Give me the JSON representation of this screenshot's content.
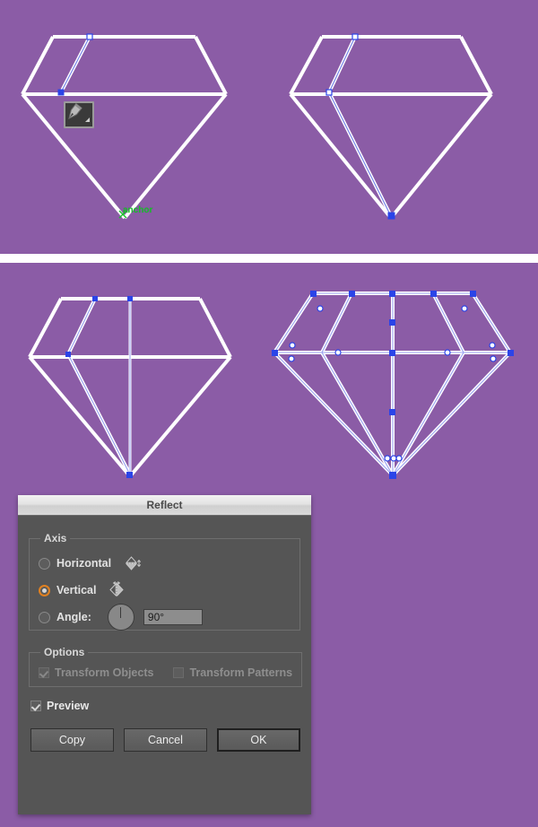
{
  "app": {
    "canvas_background": "#8b5ca6",
    "artwork_stroke": "#ffffff",
    "selection_color": "#2b44e8",
    "smart_guide_color": "#16c22a"
  },
  "canvas": {
    "top_panel": {
      "label": "pen-tool-drawing-step",
      "tool_cursor": "pen-tool-icon",
      "smart_guide_label": "anchor",
      "shapes": [
        {
          "name": "diamond-outline-step1",
          "state": "partial-facets"
        },
        {
          "name": "diamond-outline-step2",
          "state": "facet-line-added"
        }
      ]
    },
    "bottom_panel": {
      "shapes": [
        {
          "name": "diamond-outline-step3",
          "state": "center-line-added"
        },
        {
          "name": "diamond-outline-step4",
          "state": "all-selected"
        }
      ]
    }
  },
  "dialog": {
    "title": "Reflect",
    "axis": {
      "legend": "Axis",
      "options": [
        {
          "id": "horizontal",
          "label": "Horizontal",
          "selected": false,
          "icon": "reflect-horizontal-icon"
        },
        {
          "id": "vertical",
          "label": "Vertical",
          "selected": true,
          "icon": "reflect-vertical-icon"
        },
        {
          "id": "angle",
          "label": "Angle:",
          "selected": false,
          "icon": "angle-dial-icon"
        }
      ],
      "angle_value": "90°",
      "selected_radio_color": "#e08020"
    },
    "options": {
      "legend": "Options",
      "items": [
        {
          "id": "transform-objects",
          "label": "Transform Objects",
          "checked": true,
          "enabled": false
        },
        {
          "id": "transform-patterns",
          "label": "Transform Patterns",
          "checked": false,
          "enabled": false
        }
      ]
    },
    "preview": {
      "label": "Preview",
      "checked": true
    },
    "buttons": [
      {
        "id": "copy",
        "label": "Copy",
        "default": false
      },
      {
        "id": "cancel",
        "label": "Cancel",
        "default": false
      },
      {
        "id": "ok",
        "label": "OK",
        "default": true
      }
    ]
  }
}
